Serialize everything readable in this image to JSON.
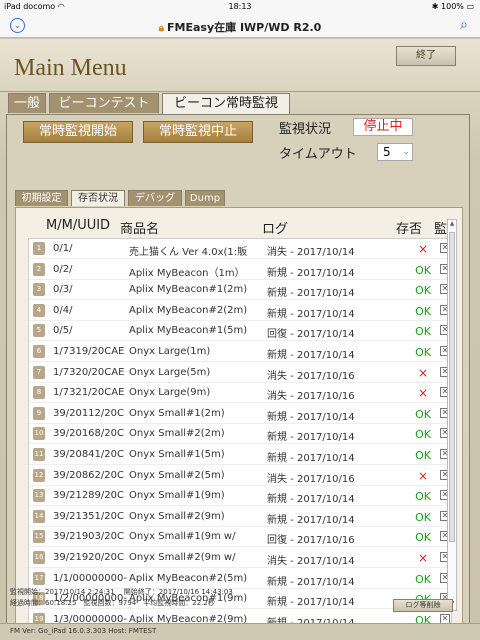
{
  "statusbar": {
    "carrier": "iPad",
    "network": "docomo",
    "time": "18:13",
    "battery": "100%"
  },
  "navbar": {
    "title": "FMEasy在庫 IWP/WD R2.0"
  },
  "header": {
    "title": "Main Menu",
    "quit": "終了"
  },
  "tabs": [
    "一般",
    "ビーコンテスト",
    "ビーコン常時監視"
  ],
  "controls": {
    "start": "常時監視開始",
    "stop": "常時監視中止",
    "status_label": "監視状況",
    "status_value": "停止中",
    "timeout_label": "タイムアウト",
    "timeout_value": "5"
  },
  "subtabs": [
    "初期設定",
    "存否状況",
    "デバッグ",
    "Dump"
  ],
  "columns": {
    "id": "M/M/UUID",
    "name": "商品名",
    "log": "ログ",
    "presence": "存否",
    "monitor": "監"
  },
  "rows": [
    {
      "num": "1",
      "id": "0/1/",
      "name": "売上猫くん Ver 4.0x(1:販",
      "log": "消失 - 2017/10/14",
      "presence": "×"
    },
    {
      "num": "2",
      "id": "0/2/",
      "name": "Aplix MyBeacon（1m）",
      "log": "新規 - 2017/10/14",
      "presence": "OK"
    },
    {
      "num": "3",
      "id": "0/3/",
      "name": "Aplix MyBeacon#1(2m)",
      "log": "新規 - 2017/10/14",
      "presence": "OK"
    },
    {
      "num": "4",
      "id": "0/4/",
      "name": "Aplix MyBeacon#2(2m)",
      "log": "新規 - 2017/10/14",
      "presence": "OK"
    },
    {
      "num": "5",
      "id": "0/5/",
      "name": "Aplix MyBeacon#1(5m)",
      "log": "回復 - 2017/10/14",
      "presence": "OK"
    },
    {
      "num": "6",
      "id": "1/7319/20CAE",
      "name": "Onyx Large(1m)",
      "log": "新規 - 2017/10/14",
      "presence": "OK"
    },
    {
      "num": "7",
      "id": "1/7320/20CAE",
      "name": "Onyx Large(5m)",
      "log": "消失 - 2017/10/16",
      "presence": "×"
    },
    {
      "num": "8",
      "id": "1/7321/20CAE",
      "name": "Onyx Large(9m)",
      "log": "消失 - 2017/10/16",
      "presence": "×"
    },
    {
      "num": "9",
      "id": "39/20112/20C",
      "name": "Onyx Small#1(2m)",
      "log": "新規 - 2017/10/14",
      "presence": "OK"
    },
    {
      "num": "10",
      "id": "39/20168/20C",
      "name": "Onyx Small#2(2m)",
      "log": "新規 - 2017/10/14",
      "presence": "OK"
    },
    {
      "num": "11",
      "id": "39/20841/20C",
      "name": "Onyx Small#1(5m)",
      "log": "新規 - 2017/10/14",
      "presence": "OK"
    },
    {
      "num": "12",
      "id": "39/20862/20C",
      "name": "Onyx Small#2(5m)",
      "log": "消失 - 2017/10/16",
      "presence": "×"
    },
    {
      "num": "13",
      "id": "39/21289/20C",
      "name": "Onyx Small#1(9m)",
      "log": "新規 - 2017/10/14",
      "presence": "OK"
    },
    {
      "num": "14",
      "id": "39/21351/20C",
      "name": "Onyx Small#2(9m)",
      "log": "新規 - 2017/10/14",
      "presence": "OK"
    },
    {
      "num": "15",
      "id": "39/21903/20C",
      "name": "Onyx Small#1(9m w/",
      "log": "回復 - 2017/10/16",
      "presence": "OK"
    },
    {
      "num": "16",
      "id": "39/21920/20C",
      "name": "Onyx Small#2(9m w/",
      "log": "消失 - 2017/10/14",
      "presence": "×"
    },
    {
      "num": "17",
      "id": "1/1/00000000-",
      "name": "Aplix MyBeacon#2(5m)",
      "log": "新規 - 2017/10/14",
      "presence": "OK"
    },
    {
      "num": "18",
      "id": "1/2/00000000-",
      "name": "Aplix MyBeacon#1(9m)",
      "log": "新規 - 2017/10/14",
      "presence": "OK"
    },
    {
      "num": "19",
      "id": "1/3/00000000-",
      "name": "Aplix MyBeacon#2(9m)",
      "log": "新規 - 2017/10/14",
      "presence": "OK"
    }
  ],
  "footer": {
    "line1": "監視開始：2017/10/14 2:24:31　 開始終了：2017/10/16 14:43:03",
    "line2": "経過時間：60:18:25　監視回数：9794　平均監視時間：22.2秒",
    "clear": "ログ等削除"
  },
  "bottombar": {
    "text": "FM Ver: Go_iPad 16.0.3.303   Host: FMTEST"
  },
  "colors": {
    "accent_blue": "#2a6ed6",
    "brand_brown": "#a4803e",
    "ok_green": "#1a9e1a",
    "ng_red": "#d52020"
  }
}
